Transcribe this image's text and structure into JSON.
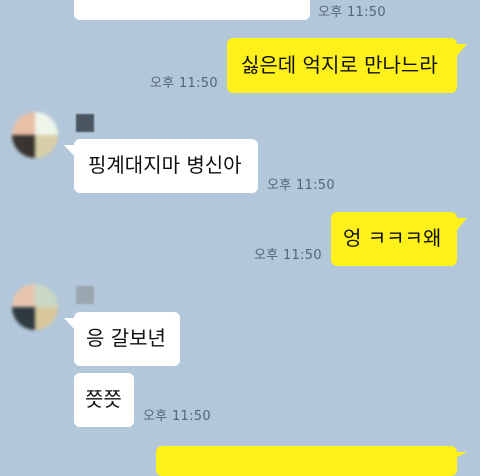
{
  "messages": [
    {
      "id": "m0",
      "sender": "other",
      "text": "",
      "time": "오후 11:50"
    },
    {
      "id": "m1",
      "sender": "me",
      "text": "싫은데 억지로 만나느라",
      "time": "오후 11:50"
    },
    {
      "id": "m2",
      "sender": "other",
      "text": "핑계대지마 병신아",
      "time": "오후 11:50"
    },
    {
      "id": "m3",
      "sender": "me",
      "text": "엉 ㅋㅋㅋ왜",
      "time": "오후 11:50"
    },
    {
      "id": "m4",
      "sender": "other",
      "text": "응 갈보년",
      "time": ""
    },
    {
      "id": "m5",
      "sender": "other",
      "text": "쯧쯧",
      "time": "오후 11:50"
    },
    {
      "id": "m6",
      "sender": "me",
      "text": "",
      "time": ""
    }
  ],
  "colors": {
    "background": "#b2c7d9",
    "my_bubble": "#fef01b",
    "their_bubble": "#ffffff",
    "timestamp": "#556677"
  },
  "icons": {
    "avatar": "blurred-profile-photo",
    "nickname": "blurred-name"
  }
}
